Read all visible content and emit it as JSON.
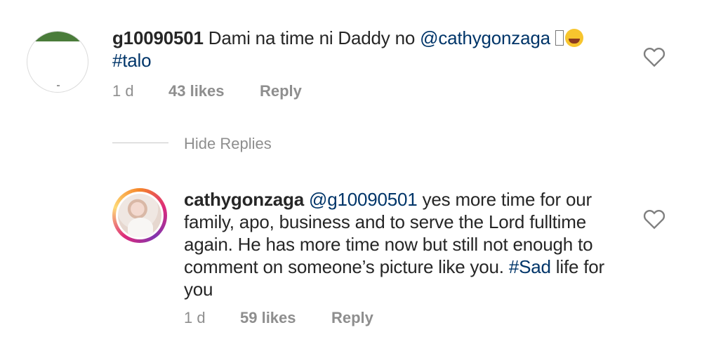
{
  "comment1": {
    "username": "g10090501",
    "text_before": " Dami na time ni Daddy no ",
    "mention": "@cathygonzaga",
    "emoji_name": "laughing-tears",
    "hashtag": "#talo",
    "time": "1 d",
    "likes": "43 likes",
    "reply": "Reply"
  },
  "hide_replies": "Hide Replies",
  "comment2": {
    "username": "cathygonzaga",
    "mention": "@g10090501",
    "text_before": " yes more time for our family, apo, business and to serve the Lord fulltime again. He has more time now but still not enough to comment on someone’s picture like you. ",
    "hashtag": "#Sad",
    "text_after": " life for you",
    "time": "1 d",
    "likes": "59 likes",
    "reply": "Reply"
  },
  "colors": {
    "link": "#003569",
    "meta": "#8e8e8e",
    "text": "#262626"
  }
}
